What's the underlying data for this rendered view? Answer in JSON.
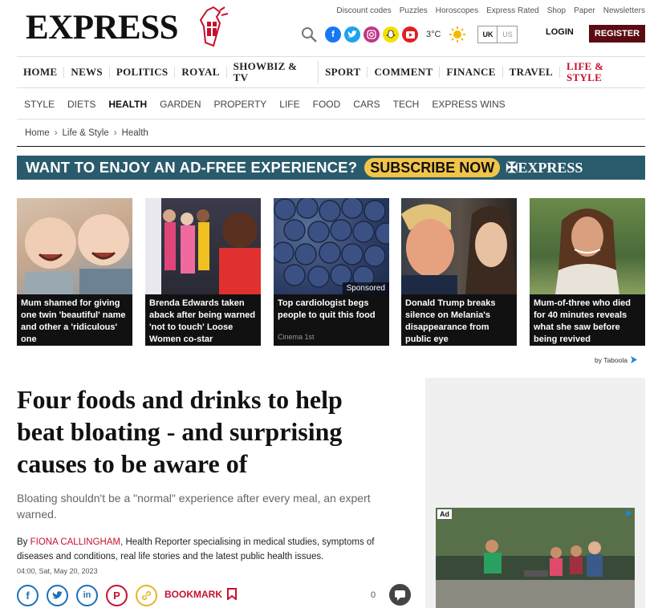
{
  "brand": {
    "logo_text": "EXPRESS",
    "register_color": "#5a0c12",
    "accent_color": "#c8102e"
  },
  "top_links": [
    "Discount codes",
    "Puzzles",
    "Horoscopes",
    "Express Rated",
    "Shop",
    "Paper",
    "Newsletters"
  ],
  "tools": {
    "temperature": "3°C",
    "region_active": "UK",
    "region_inactive": "US",
    "login": "LOGIN",
    "register": "REGISTER"
  },
  "main_nav": [
    {
      "label": "HOME"
    },
    {
      "label": "NEWS"
    },
    {
      "label": "POLITICS"
    },
    {
      "label": "ROYAL"
    },
    {
      "label": "SHOWBIZ & TV"
    },
    {
      "label": "SPORT"
    },
    {
      "label": "COMMENT"
    },
    {
      "label": "FINANCE"
    },
    {
      "label": "TRAVEL"
    },
    {
      "label": "LIFE & STYLE",
      "active": true
    }
  ],
  "sub_nav": [
    {
      "label": "STYLE"
    },
    {
      "label": "DIETS"
    },
    {
      "label": "HEALTH",
      "active": true
    },
    {
      "label": "GARDEN"
    },
    {
      "label": "PROPERTY"
    },
    {
      "label": "LIFE"
    },
    {
      "label": "FOOD"
    },
    {
      "label": "CARS"
    },
    {
      "label": "TECH"
    },
    {
      "label": "EXPRESS WINS"
    }
  ],
  "breadcrumb": [
    "Home",
    "Life & Style",
    "Health"
  ],
  "banner": {
    "text": "WANT TO ENJOY AN AD-FREE EXPERIENCE?",
    "cta": "SUBSCRIBE NOW",
    "brand": "EXPRESS",
    "bg_color": "#2a5b6c",
    "cta_color": "#f1c54a"
  },
  "cards": [
    {
      "caption": "Mum shamed for giving one twin 'beautiful' name and other a 'ridiculous' one"
    },
    {
      "caption": "Brenda Edwards taken aback after being warned 'not to touch' Loose Women co-star"
    },
    {
      "caption": "Top cardiologist begs people to quit this food",
      "sponsored": "Sponsored",
      "source": "Cinema 1st"
    },
    {
      "caption": "Donald Trump breaks silence on Melania's disappearance from public eye"
    },
    {
      "caption": "Mum-of-three who died for 40 minutes reveals what she saw before being revived"
    }
  ],
  "taboola": "by Taboola",
  "article": {
    "headline": "Four foods and drinks to help beat bloating - and surprising causes to be aware of",
    "standfirst": "Bloating shouldn't be a \"normal\" experience after every meal, an expert warned.",
    "by_prefix": "By",
    "author": "FIONA CALLINGHAM",
    "author_desc": ", Health Reporter specialising in medical studies, symptoms of diseases and conditions, real life stories and the latest public health issues.",
    "date": "04:00, Sat, May 20, 2023",
    "bookmark": "BOOKMARK",
    "comment_count": "0"
  },
  "ad": {
    "label": "Ad"
  }
}
